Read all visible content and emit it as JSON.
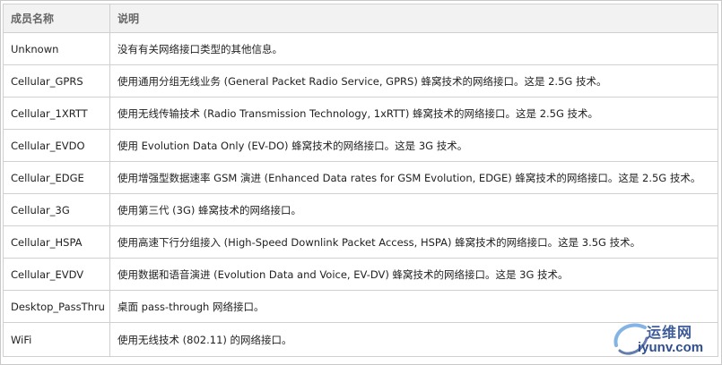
{
  "table": {
    "headers": {
      "name": "成员名称",
      "description": "说明"
    },
    "rows": [
      {
        "name": "Unknown",
        "description": "没有有关网络接口类型的其他信息。"
      },
      {
        "name": "Cellular_GPRS",
        "description": "使用通用分组无线业务 (General Packet Radio Service, GPRS) 蜂窝技术的网络接口。这是 2.5G 技术。"
      },
      {
        "name": "Cellular_1XRTT",
        "description": "使用无线传输技术 (Radio Transmission Technology, 1xRTT) 蜂窝技术的网络接口。这是 2.5G 技术。"
      },
      {
        "name": "Cellular_EVDO",
        "description": "使用 Evolution Data Only (EV-DO) 蜂窝技术的网络接口。这是 3G 技术。"
      },
      {
        "name": "Cellular_EDGE",
        "description": "使用增强型数据速率 GSM 演进 (Enhanced Data rates for GSM Evolution, EDGE) 蜂窝技术的网络接口。这是 2.5G 技术。"
      },
      {
        "name": "Cellular_3G",
        "description": "使用第三代 (3G) 蜂窝技术的网络接口。"
      },
      {
        "name": "Cellular_HSPA",
        "description": "使用高速下行分组接入 (High-Speed Downlink Packet Access, HSPA) 蜂窝技术的网络接口。这是 3.5G 技术。"
      },
      {
        "name": "Cellular_EVDV",
        "description": "使用数据和语音演进 (Evolution Data and Voice, EV-DV) 蜂窝技术的网络接口。这是 3G 技术。"
      },
      {
        "name": "Desktop_PassThru",
        "description": "桌面 pass-through 网络接口。"
      },
      {
        "name": "WiFi",
        "description": "使用无线技术 (802.11) 的网络接口。"
      }
    ]
  },
  "watermark": {
    "cn": "运维网",
    "en": "iyunv.com"
  },
  "colors": {
    "header_bg": "#f2f2f2",
    "border": "#d0d0d0",
    "watermark": "#3f5d9a"
  }
}
